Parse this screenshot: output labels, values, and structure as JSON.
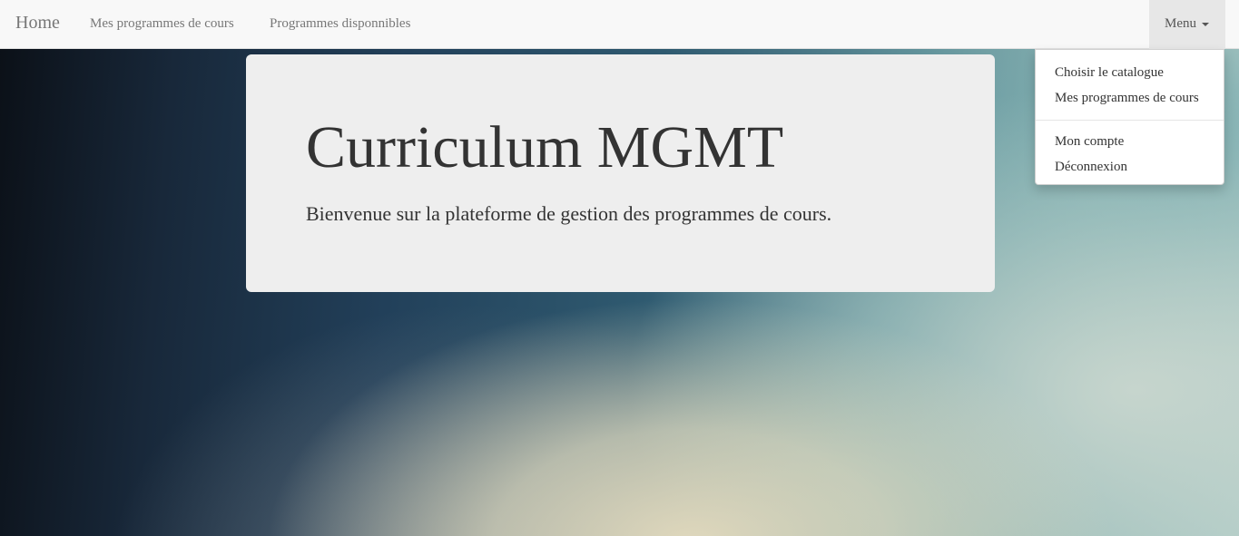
{
  "navbar": {
    "brand": "Home",
    "links": [
      "Mes programmes de cours",
      "Programmes disponnibles"
    ],
    "menu_label": "Menu"
  },
  "dropdown": {
    "items": [
      "Choisir le catalogue",
      "Mes programmes de cours",
      "Mon compte",
      "Déconnexion"
    ]
  },
  "jumbotron": {
    "title": "Curriculum MGMT",
    "subtitle": "Bienvenue sur la plateforme de gestion des programmes de cours."
  }
}
